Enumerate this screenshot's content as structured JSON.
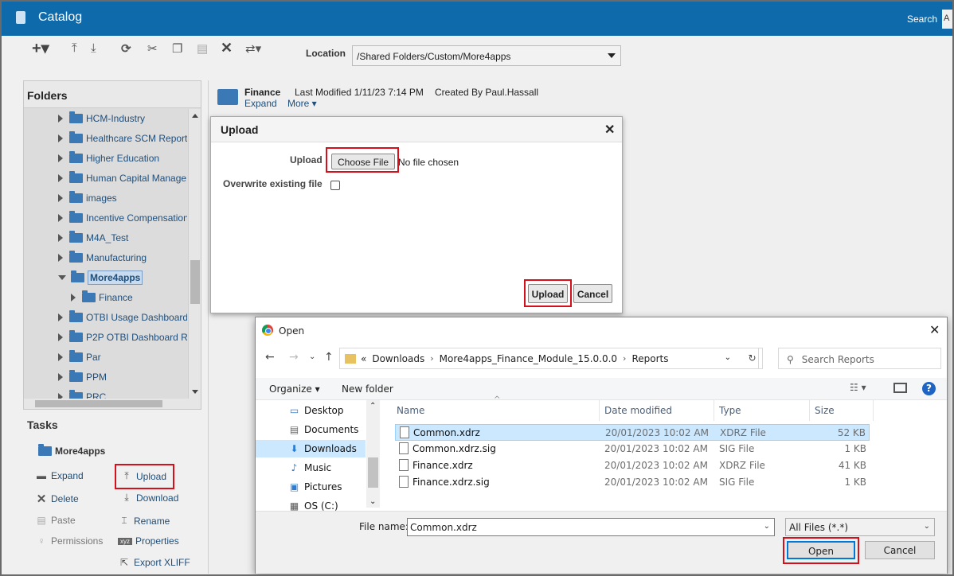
{
  "app": {
    "title": "Catalog",
    "search_label": "Search",
    "search_box_char": "A"
  },
  "toolbar": {
    "icons": [
      "new-icon",
      "upload-icon",
      "download-icon",
      "refresh-icon",
      "cut-icon",
      "copy-icon",
      "paste-icon",
      "delete-icon",
      "more-actions-icon"
    ],
    "location_label": "Location",
    "location_value": "/Shared Folders/Custom/More4apps"
  },
  "folders": {
    "heading": "Folders",
    "items": [
      {
        "label": "HCM-Industry",
        "level": 0
      },
      {
        "label": "Healthcare SCM Report",
        "level": 0
      },
      {
        "label": "Higher Education",
        "level": 0
      },
      {
        "label": "Human Capital Manage",
        "level": 0
      },
      {
        "label": "images",
        "level": 0
      },
      {
        "label": "Incentive Compensation",
        "level": 0
      },
      {
        "label": "M4A_Test",
        "level": 0
      },
      {
        "label": "Manufacturing",
        "level": 0
      },
      {
        "label": "More4apps",
        "level": 0,
        "expanded": true,
        "selected": true
      },
      {
        "label": "Finance",
        "level": 1
      },
      {
        "label": "OTBI Usage Dashboard",
        "level": 0
      },
      {
        "label": "P2P OTBI Dashboard R",
        "level": 0
      },
      {
        "label": "Par",
        "level": 0
      },
      {
        "label": "PPM",
        "level": 0
      },
      {
        "label": "PRC",
        "level": 0
      }
    ]
  },
  "tasks": {
    "heading": "Tasks",
    "folder": "More4apps",
    "expand": "Expand",
    "upload": "Upload",
    "delete": "Delete",
    "download": "Download",
    "paste": "Paste",
    "rename": "Rename",
    "permissions": "Permissions",
    "properties": "Properties",
    "properties_icon_text": "xyz",
    "export": "Export XLIFF"
  },
  "folder_info": {
    "name": "Finance",
    "modified": "Last Modified 1/11/23 7:14 PM",
    "created": "Created By Paul.Hassall",
    "expand": "Expand",
    "more": "More ▾"
  },
  "upload_dialog": {
    "title": "Upload",
    "close": "✕",
    "upload_label": "Upload",
    "choose_file": "Choose File",
    "no_file": "No file chosen",
    "overwrite_label": "Overwrite existing file",
    "upload_button": "Upload",
    "cancel_button": "Cancel"
  },
  "open_dialog": {
    "title": "Open",
    "close": "✕",
    "breadcrumbs": [
      "«",
      "Downloads",
      "More4apps_Finance_Module_15.0.0.0",
      "Reports"
    ],
    "search_placeholder": "Search Reports",
    "organize": "Organize ▾",
    "new_folder": "New folder",
    "nav_items": [
      {
        "label": "Desktop",
        "icon": "desktop-icon"
      },
      {
        "label": "Documents",
        "icon": "documents-icon"
      },
      {
        "label": "Downloads",
        "icon": "downloads-icon",
        "active": true
      },
      {
        "label": "Music",
        "icon": "music-icon"
      },
      {
        "label": "Pictures",
        "icon": "pictures-icon"
      },
      {
        "label": "OS (C:)",
        "icon": "drive-icon"
      }
    ],
    "columns": [
      "Name",
      "Date modified",
      "Type",
      "Size"
    ],
    "files": [
      {
        "name": "Common.xdrz",
        "date": "20/01/2023 10:02 AM",
        "type": "XDRZ File",
        "size": "52 KB",
        "selected": true
      },
      {
        "name": "Common.xdrz.sig",
        "date": "20/01/2023 10:02 AM",
        "type": "SIG File",
        "size": "1 KB"
      },
      {
        "name": "Finance.xdrz",
        "date": "20/01/2023 10:02 AM",
        "type": "XDRZ File",
        "size": "41 KB"
      },
      {
        "name": "Finance.xdrz.sig",
        "date": "20/01/2023 10:02 AM",
        "type": "SIG File",
        "size": "1 KB"
      }
    ],
    "filename_label": "File name:",
    "filename_value": "Common.xdrz",
    "filetype_value": "All Files (*.*)",
    "open_button": "Open",
    "cancel_button": "Cancel"
  },
  "colors": {
    "header_blue": "#0f6aab",
    "highlight_red": "#d6101b",
    "folder_blue": "#3a78b6",
    "win_select": "#cce8ff"
  }
}
